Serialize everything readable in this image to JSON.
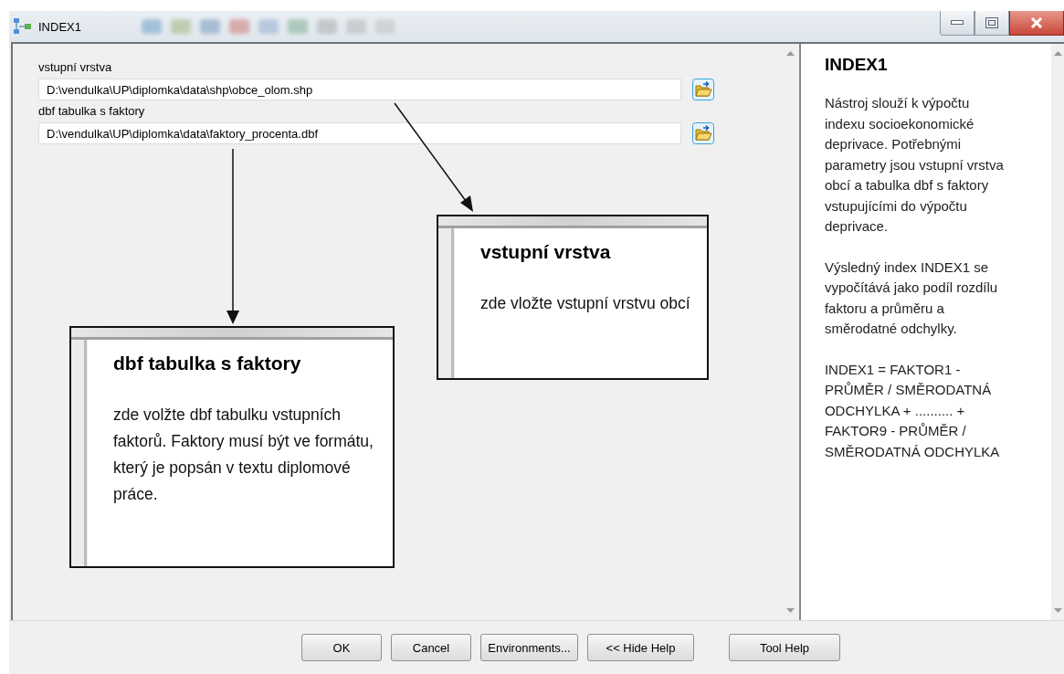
{
  "window": {
    "title": "INDEX1"
  },
  "parameters": [
    {
      "label": "vstupní vrstva",
      "value": "D:\\vendulka\\UP\\diplomka\\data\\shp\\obce_olom.shp"
    },
    {
      "label": "dbf tabulka s faktory",
      "value": "D:\\vendulka\\UP\\diplomka\\data\\faktory_procenta.dbf"
    }
  ],
  "callouts": [
    {
      "title": "vstupní vrstva",
      "text": "zde vložte vstupní vrstvu obcí"
    },
    {
      "title": "dbf tabulka s faktory",
      "text": "zde volžte dbf tabulku vstupních faktorů. Faktory musí být ve formátu, který je popsán v textu diplomové práce."
    }
  ],
  "help": {
    "title": "INDEX1",
    "paragraphs": [
      "Nástroj slouží k výpočtu indexu socioekonomické deprivace. Potřebnými parametry jsou vstupní vrstva obcí a tabulka dbf s faktory vstupujícími do výpočtu deprivace.",
      "Výsledný index INDEX1 se vypočítává jako podíl rozdílu faktoru a průměru a směrodatné odchylky.",
      "INDEX1 = FAKTOR1 - PRŮMĚR / SMĚRODATNÁ ODCHYLKA + .......... + FAKTOR9 - PRŮMĚR / SMĚRODATNÁ ODCHYLKA"
    ]
  },
  "buttons": [
    "OK",
    "Cancel",
    "Environments...",
    "<< Hide Help",
    "Tool Help"
  ]
}
